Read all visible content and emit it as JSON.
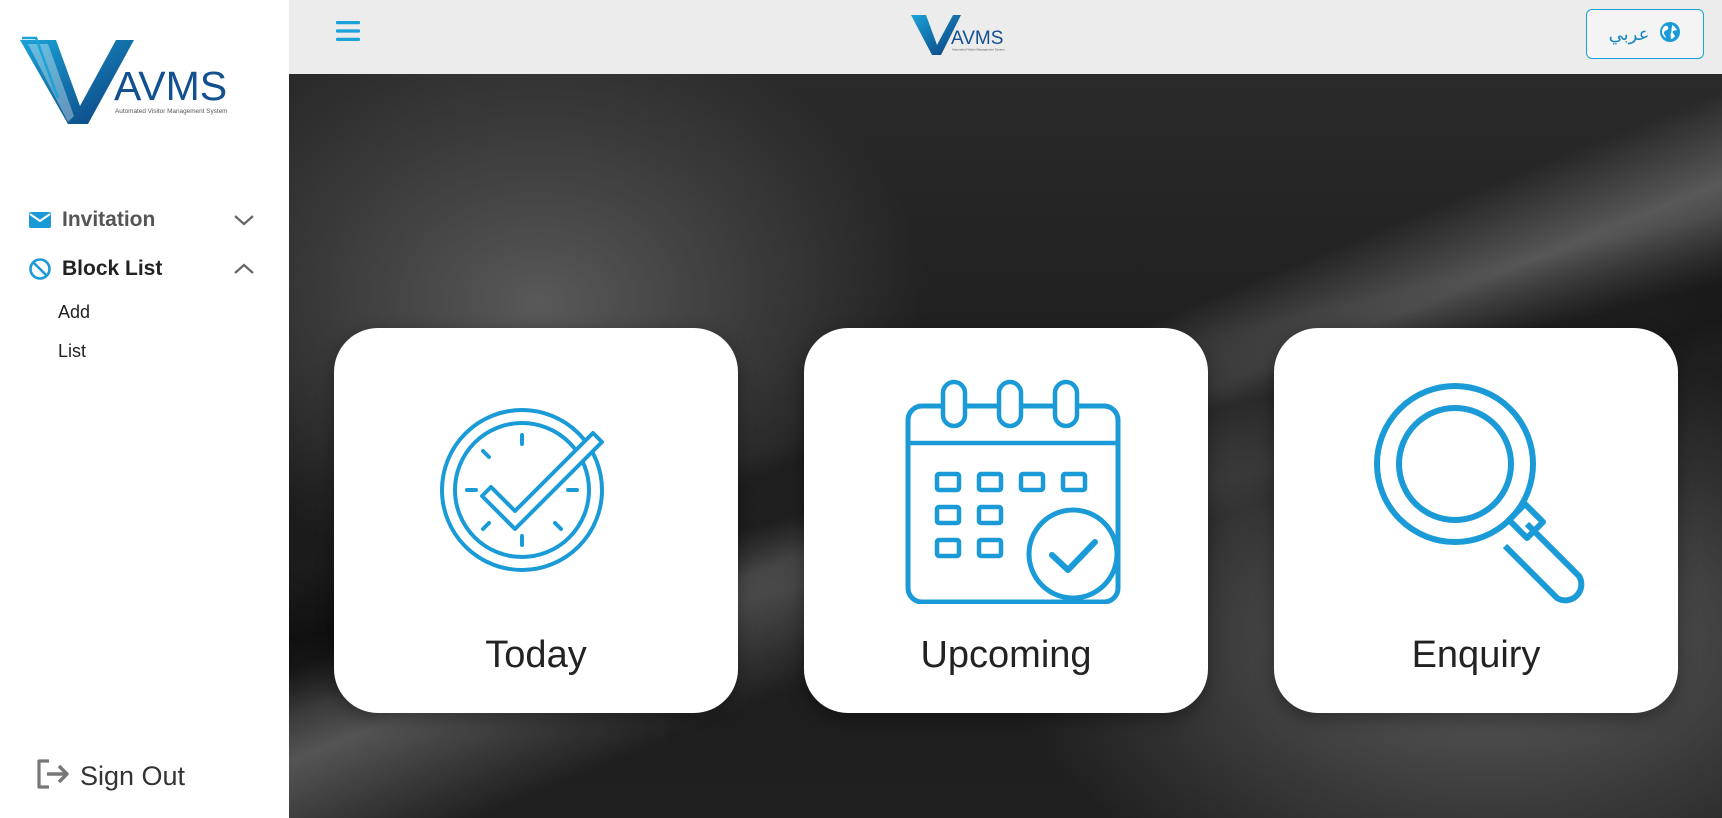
{
  "brand": {
    "logo_text": "AVMS",
    "logo_tagline": "Automated Visitor Management System",
    "accent_color": "#1a9bd7",
    "dark_blue": "#0f3d7a"
  },
  "header": {
    "language_button_label": "عربي",
    "language_icon": "globe-icon",
    "menu_icon": "hamburger-menu-icon"
  },
  "sidebar": {
    "items": [
      {
        "label": "Invitation",
        "icon": "envelope-icon",
        "expanded": false
      },
      {
        "label": "Block List",
        "icon": "ban-icon",
        "expanded": true,
        "children": [
          {
            "label": "Add"
          },
          {
            "label": "List"
          }
        ]
      }
    ],
    "signout_label": "Sign Out",
    "signout_icon": "sign-out-icon"
  },
  "cards": [
    {
      "label": "Today",
      "icon": "clock-check-icon"
    },
    {
      "label": "Upcoming",
      "icon": "calendar-check-icon"
    },
    {
      "label": "Enquiry",
      "icon": "magnifier-icon"
    }
  ]
}
